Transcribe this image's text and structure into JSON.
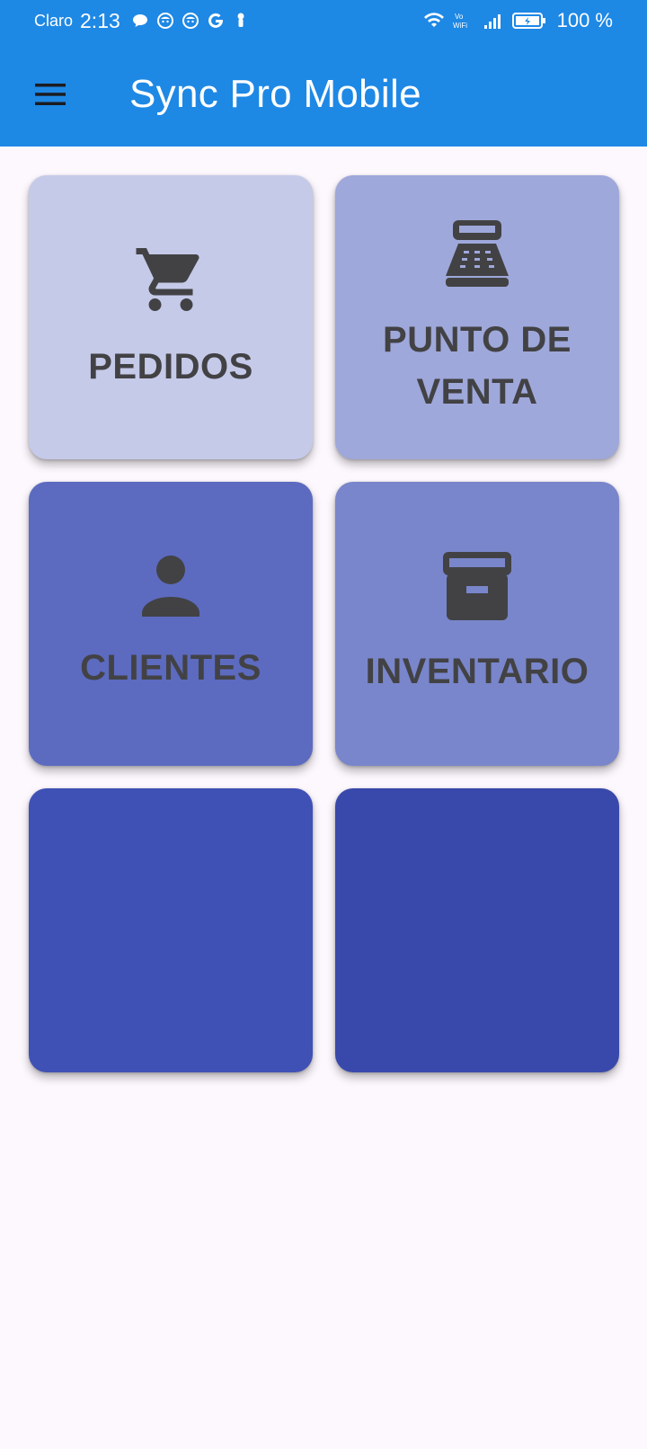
{
  "status_bar": {
    "carrier": "Claro",
    "time": "2:13",
    "left_icons": [
      "chat-bubble-icon",
      "face-icon",
      "face-icon",
      "google-icon",
      "location-pin-icon"
    ],
    "right_icons": [
      "wifi-icon",
      "vowifi-icon",
      "signal-icon",
      "battery-charging-icon"
    ],
    "vowifi_label": "Vo\nWiFi",
    "battery_percent": "100 %"
  },
  "app_bar": {
    "title": "Sync Pro Mobile",
    "menu_icon": "hamburger-menu-icon",
    "background_color": "#1e88e5"
  },
  "tiles": [
    {
      "label": "PEDIDOS",
      "icon": "cart-icon",
      "color": "#c5cae9"
    },
    {
      "label": "PUNTO DE VENTA",
      "icon": "cash-register-icon",
      "color": "#9fa8da"
    },
    {
      "label": "CLIENTES",
      "icon": "person-icon",
      "color": "#5c6bc0"
    },
    {
      "label": "INVENTARIO",
      "icon": "archive-box-icon",
      "color": "#7986cb"
    },
    {
      "label": "",
      "icon": "",
      "color": "#3f51b5"
    },
    {
      "label": "",
      "icon": "",
      "color": "#3949ab"
    }
  ]
}
